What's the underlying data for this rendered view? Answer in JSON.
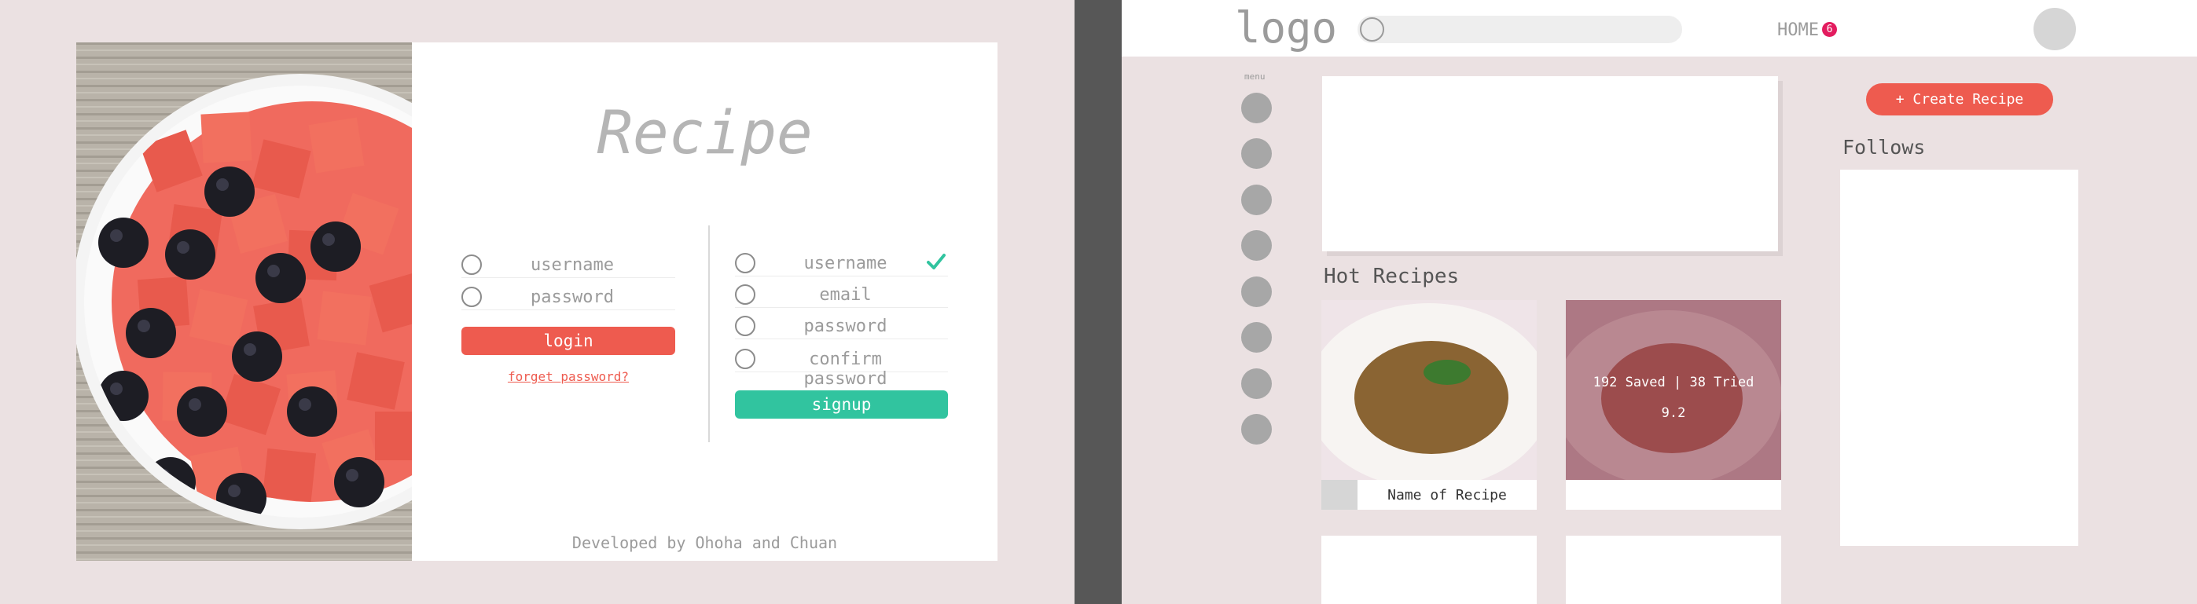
{
  "login": {
    "title": "Recipe",
    "login_form": {
      "username": "username",
      "password": "password",
      "button": "login",
      "forgot": "forget password?"
    },
    "signup_form": {
      "username": "username",
      "email": "email",
      "password": "password",
      "confirm": "confirm password",
      "button": "signup"
    },
    "credits": "Developed by Ohoha and Chuan"
  },
  "home": {
    "logo": "logo",
    "nav_home": "HOME",
    "notification_count": "6",
    "menu_caption": "menu",
    "hot_heading": "Hot Recipes",
    "recipe_name": "Name of Recipe",
    "recipe_stats": "192 Saved | 38 Tried",
    "recipe_score": "9.2",
    "create_button": "+ Create Recipe",
    "follows_heading": "Follows"
  },
  "colors": {
    "background": "#ebe1e2",
    "accent_red": "#ee5b4f",
    "accent_green": "#31c49f",
    "badge": "#e31c5f",
    "divider": "#575757"
  },
  "icons": [
    "radio-icon",
    "check-icon",
    "search-icon",
    "avatar-icon",
    "menu-icon"
  ]
}
